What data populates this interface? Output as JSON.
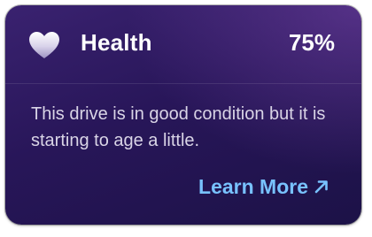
{
  "health": {
    "title": "Health",
    "percent": "75%",
    "icon": "heart-icon",
    "description": "This drive is in good condition but it is starting to age a little.",
    "link_label": "Learn More",
    "link_icon": "arrow-up-right-icon",
    "colors": {
      "card_background": "#281659",
      "link": "#78c2ff",
      "text": "#ffffff",
      "description": "#d9d4e6"
    }
  }
}
